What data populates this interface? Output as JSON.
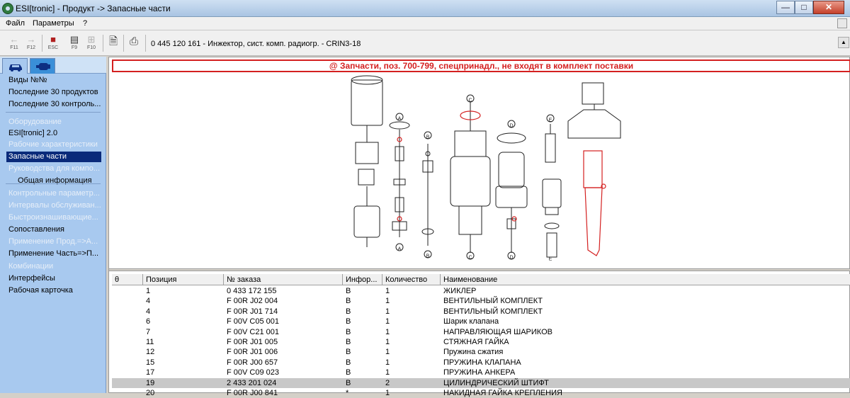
{
  "window": {
    "title": "ESI[tronic] - Продукт -> Запасные части",
    "controls": {
      "minimize": "—",
      "maximize": "□",
      "close": "✕"
    }
  },
  "menu": {
    "items": [
      "Файл",
      "Параметры",
      "?"
    ]
  },
  "toolbar": {
    "back_key": "F11",
    "forward_key": "F12",
    "esc_key": "ESC",
    "f9_key": "F9",
    "f10_key": "F10",
    "product_line": "0 445 120 161 - Инжектор, сист. комп. радиогр. - CRIN3-18"
  },
  "sidebar": {
    "items": [
      {
        "label": "Виды №№",
        "state": "normal"
      },
      {
        "label": "Последние 30 продуктов",
        "state": "normal"
      },
      {
        "label": "Последние 30 контроль...",
        "state": "normal"
      },
      {
        "label": "Оборудование",
        "state": "dim"
      },
      {
        "label": "ESI[tronic] 2.0",
        "state": "normal"
      },
      {
        "label": "Рабочие характеристики",
        "state": "dim"
      },
      {
        "label": "Запасные части",
        "state": "selected"
      },
      {
        "label": "Руководства для компо...",
        "state": "dim"
      },
      {
        "label": "Общая информация",
        "state": "sub"
      },
      {
        "label": "Контрольные параметр...",
        "state": "dim"
      },
      {
        "label": "Интервалы обслуживан...",
        "state": "dim"
      },
      {
        "label": "Быстроизнашивающие...",
        "state": "dim"
      },
      {
        "label": "Сопоставления",
        "state": "normal"
      },
      {
        "label": "Применение Прод.=>А...",
        "state": "dim"
      },
      {
        "label": "Применение Часть=>П...",
        "state": "normal"
      },
      {
        "label": "Комбинации",
        "state": "dim"
      },
      {
        "label": "Интерфейсы",
        "state": "normal"
      },
      {
        "label": "Рабочая карточка",
        "state": "normal"
      }
    ]
  },
  "banner": "@ Запчасти, поз. 700-799, спецпринадл., не входят в комплект поставки",
  "diagram": {
    "callouts": [
      "A",
      "B",
      "C",
      "D",
      "E",
      "A",
      "B",
      "C",
      "D",
      "E"
    ],
    "accent": "#d42020"
  },
  "table": {
    "columns": [
      "θ",
      "Позиция",
      "№ заказа",
      "Инфор...",
      "Количество",
      "Наименование"
    ],
    "rows": [
      {
        "pos": "1",
        "order": "0 433 172 155",
        "info": "B",
        "qty": "1",
        "name": "ЖИКЛЕР"
      },
      {
        "pos": "4",
        "order": "F 00R J02 004",
        "info": "B",
        "qty": "1",
        "name": "ВЕНТИЛЬНЫЙ КОМПЛЕКТ"
      },
      {
        "pos": "4",
        "order": "F 00R J01 714",
        "info": "B",
        "qty": "1",
        "name": "ВЕНТИЛЬНЫЙ КОМПЛЕКТ"
      },
      {
        "pos": "6",
        "order": "F 00V C05 001",
        "info": "B",
        "qty": "1",
        "name": "Шарик клапана"
      },
      {
        "pos": "7",
        "order": "F 00V C21 001",
        "info": "B",
        "qty": "1",
        "name": "НАПРАВЛЯЮЩАЯ ШАРИКОВ"
      },
      {
        "pos": "11",
        "order": "F 00R J01 005",
        "info": "B",
        "qty": "1",
        "name": "СТЯЖНАЯ ГАЙКА"
      },
      {
        "pos": "12",
        "order": "F 00R J01 006",
        "info": "B",
        "qty": "1",
        "name": "Пружина сжатия"
      },
      {
        "pos": "15",
        "order": "F 00R J00 657",
        "info": "B",
        "qty": "1",
        "name": "ПРУЖИНА КЛАПАНА"
      },
      {
        "pos": "17",
        "order": "F 00V C09 023",
        "info": "B",
        "qty": "1",
        "name": "ПРУЖИНА АНКЕРА"
      },
      {
        "pos": "19",
        "order": "2 433 201 024",
        "info": "B",
        "qty": "2",
        "name": "ЦИЛИНДРИЧЕСКИЙ ШТИФТ"
      },
      {
        "pos": "20",
        "order": "F 00R J00 841",
        "info": "*",
        "qty": "1",
        "name": "НАКИДНАЯ ГАЙКА КРЕПЛЕНИЯ"
      }
    ],
    "selected_row_index": 9
  }
}
